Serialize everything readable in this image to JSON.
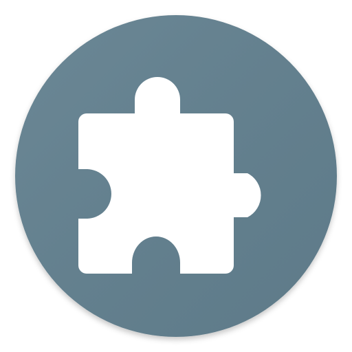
{
  "icon": {
    "name": "extension-puzzle-icon",
    "background_color": "#62808F",
    "foreground_color": "#FFFFFF"
  }
}
